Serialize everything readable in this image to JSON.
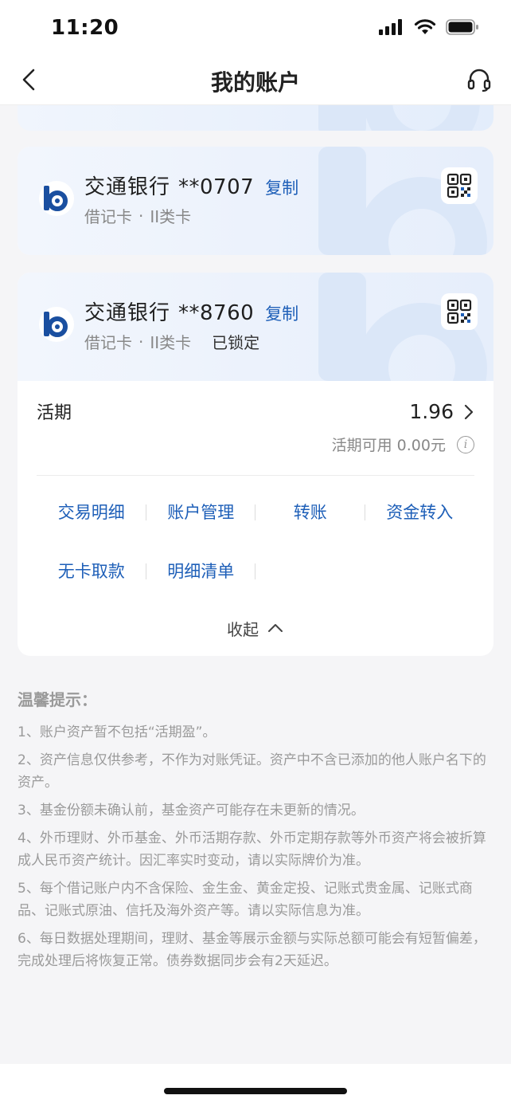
{
  "status": {
    "time": "11:20"
  },
  "nav": {
    "title": "我的账户"
  },
  "cards": [
    {
      "bank": "交通银行",
      "number": "**0707",
      "copy_label": "复制",
      "type": "借记卡",
      "dot": "·",
      "class": "II类卡"
    },
    {
      "bank": "交通银行",
      "number": "**8760",
      "copy_label": "复制",
      "type": "借记卡",
      "dot": "·",
      "class": "II类卡",
      "status": "已锁定",
      "balance_label": "活期",
      "balance": "1.96",
      "available": "活期可用 0.00元",
      "actions": [
        "交易明细",
        "账户管理",
        "转账",
        "资金转入",
        "无卡取款",
        "明细清单"
      ],
      "collapse_label": "收起"
    }
  ],
  "tips": {
    "title": "温馨提示：",
    "items": [
      "1、账户资产暂不包括“活期盈”。",
      "2、资产信息仅供参考，不作为对账凭证。资产中不含已添加的他人账户名下的资产。",
      "3、基金份额未确认前，基金资产可能存在未更新的情况。",
      "4、外币理财、外币基金、外币活期存款、外币定期存款等外币资产将会被折算成人民币资产统计。因汇率实时变动，请以实际牌价为准。",
      "5、每个借记账户内不含保险、金生金、黄金定投、记账式贵金属、记账式商品、记账式原油、信托及海外资产等。请以实际信息为准。",
      "6、每日数据处理期间，理财、基金等展示金额与实际总额可能会有短暂偏差，完成处理后将恢复正常。债券数据同步会有2天延迟。"
    ]
  },
  "colors": {
    "accent": "#1e5fb8",
    "logo": "#1a4fa0"
  }
}
